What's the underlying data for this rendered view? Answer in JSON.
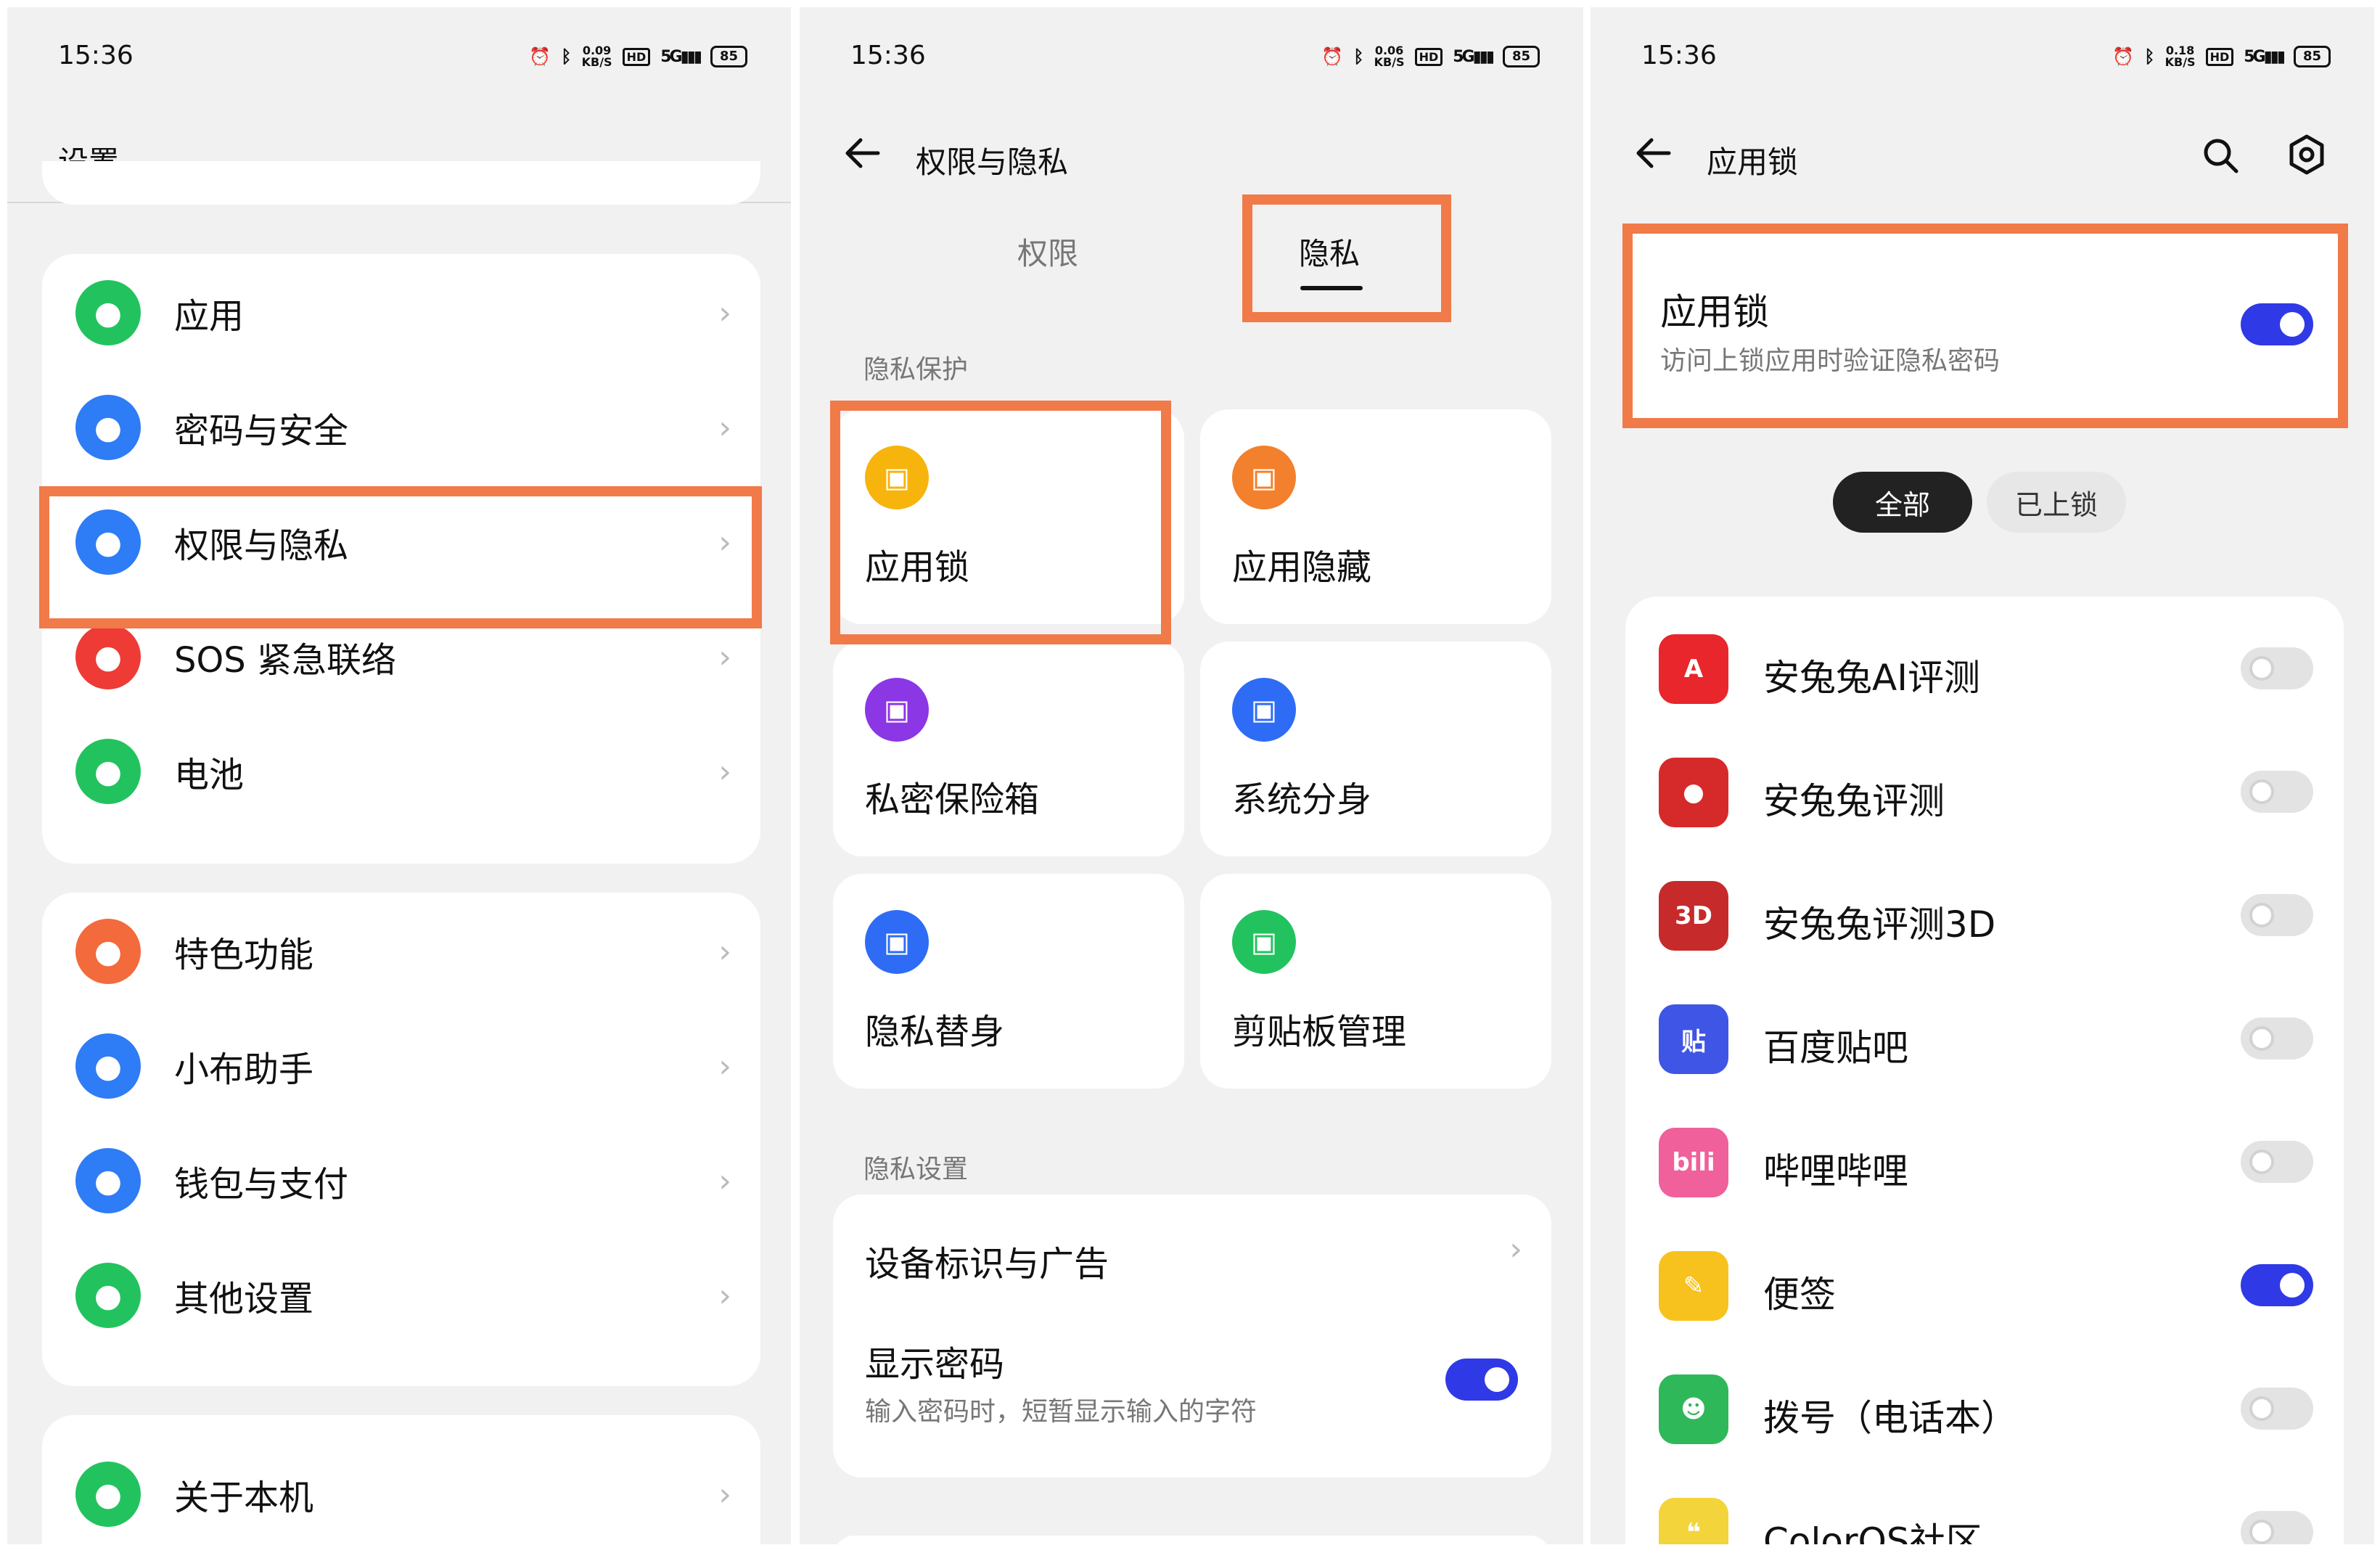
{
  "status_bars": [
    {
      "time": "15:36",
      "net_speed": "0.09",
      "net_unit": "KB/S",
      "hd": "HD",
      "signal": "5G",
      "battery": "85"
    },
    {
      "time": "15:36",
      "net_speed": "0.06",
      "net_unit": "KB/S",
      "hd": "HD",
      "signal": "5G",
      "battery": "85"
    },
    {
      "time": "15:36",
      "net_speed": "0.18",
      "net_unit": "KB/S",
      "hd": "HD",
      "signal": "5G",
      "battery": "85"
    }
  ],
  "settings": {
    "title": "设置",
    "group1": [
      {
        "label": "应用",
        "icon": "apps-icon",
        "color": "#22c35e"
      },
      {
        "label": "密码与安全",
        "icon": "key-icon",
        "color": "#2e7cf6"
      },
      {
        "label": "权限与隐私",
        "icon": "privacy-eye-icon",
        "color": "#2e7cf6"
      },
      {
        "label": "SOS 紧急联络",
        "icon": "sos-asterisk-icon",
        "color": "#ee3b36"
      },
      {
        "label": "电池",
        "icon": "battery-icon",
        "color": "#22c35e"
      }
    ],
    "group2": [
      {
        "label": "特色功能",
        "icon": "star-icon",
        "color": "#f36a3c"
      },
      {
        "label": "小布助手",
        "icon": "assistant-icon",
        "color": "#2e7cf6"
      },
      {
        "label": "钱包与支付",
        "icon": "wallet-icon",
        "color": "#2e7cf6"
      },
      {
        "label": "其他设置",
        "icon": "gear-icon",
        "color": "#22c35e"
      }
    ],
    "group3": [
      {
        "label": "关于本机",
        "icon": "phone-icon",
        "color": "#22c35e"
      }
    ]
  },
  "privacy": {
    "title": "权限与隐私",
    "tabs": [
      "权限",
      "隐私"
    ],
    "active_tab": "隐私",
    "section_protect": "隐私保护",
    "tiles": [
      {
        "label": "应用锁",
        "icon": "app-lock-icon",
        "color": "#f6b40c"
      },
      {
        "label": "应用隐藏",
        "icon": "app-hide-icon",
        "color": "#f3802c"
      },
      {
        "label": "私密保险箱",
        "icon": "safe-box-icon",
        "color": "#8b37e6"
      },
      {
        "label": "系统分身",
        "icon": "clone-icon",
        "color": "#2e6cf6"
      },
      {
        "label": "隐私替身",
        "icon": "privacy-double-icon",
        "color": "#2e6cf6"
      },
      {
        "label": "剪贴板管理",
        "icon": "clipboard-icon",
        "color": "#22c35e"
      }
    ],
    "section_settings": "隐私设置",
    "device_id_label": "设备标识与广告",
    "show_password_label": "显示密码",
    "show_password_desc": "输入密码时，短暂显示输入的字符",
    "show_password_on": true
  },
  "applock": {
    "title": "应用锁",
    "main_title": "应用锁",
    "main_desc": "访问上锁应用时验证隐私密码",
    "main_on": true,
    "filters": [
      "全部",
      "已上锁"
    ],
    "active_filter": "全部",
    "apps": [
      {
        "label": "安兔兔AI评测",
        "icon": "antutu-ai-icon",
        "on": false,
        "color": "#e8262b",
        "glyph": "A"
      },
      {
        "label": "安兔兔评测",
        "icon": "antutu-icon",
        "on": false,
        "color": "#d62a2a",
        "glyph": "●"
      },
      {
        "label": "安兔兔评测3D",
        "icon": "antutu-3d-icon",
        "on": false,
        "color": "#c62a2a",
        "glyph": "3D"
      },
      {
        "label": "百度贴吧",
        "icon": "tieba-icon",
        "on": false,
        "color": "#3f55e6",
        "glyph": "贴"
      },
      {
        "label": "哔哩哔哩",
        "icon": "bilibili-icon",
        "on": false,
        "color": "#f0609a",
        "glyph": "bili"
      },
      {
        "label": "便签",
        "icon": "notes-icon",
        "on": true,
        "color": "#f7c21d",
        "glyph": "✎"
      },
      {
        "label": "拨号（电话本）",
        "icon": "contacts-icon",
        "on": false,
        "color": "#2fb85a",
        "glyph": "☻"
      },
      {
        "label": "ColorOS社区",
        "icon": "coloros-community-icon",
        "on": false,
        "color": "#f3d43a",
        "glyph": "❝"
      }
    ]
  },
  "colors": {
    "accent": "#2f39e6",
    "highlight": "#f07a48",
    "background": "#f1f1f1"
  }
}
